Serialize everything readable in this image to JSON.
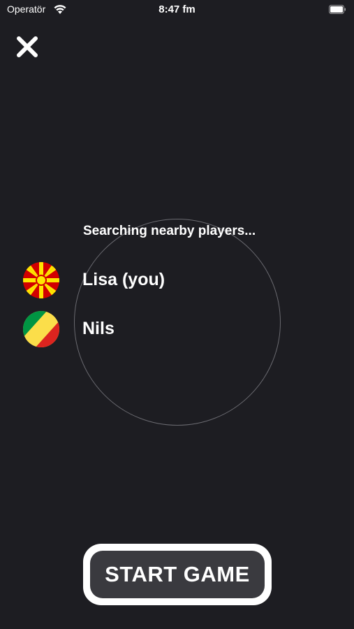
{
  "status_bar": {
    "carrier": "Operatör",
    "time": "8:47 fm",
    "wifi_icon": "wifi-icon",
    "battery_icon": "battery-icon"
  },
  "close_icon": "close-icon",
  "searching_text": "Searching nearby players...",
  "players": [
    {
      "name": "Lisa (you)",
      "flag": "north-macedonia-flag-icon"
    },
    {
      "name": "Nils",
      "flag": "republic-of-congo-flag-icon"
    }
  ],
  "start_button": {
    "label": "START GAME"
  },
  "colors": {
    "background": "#1d1d22",
    "button_fill": "#3a3a3f",
    "button_border": "#ffffff",
    "radar_stroke": "#6a6a70"
  }
}
